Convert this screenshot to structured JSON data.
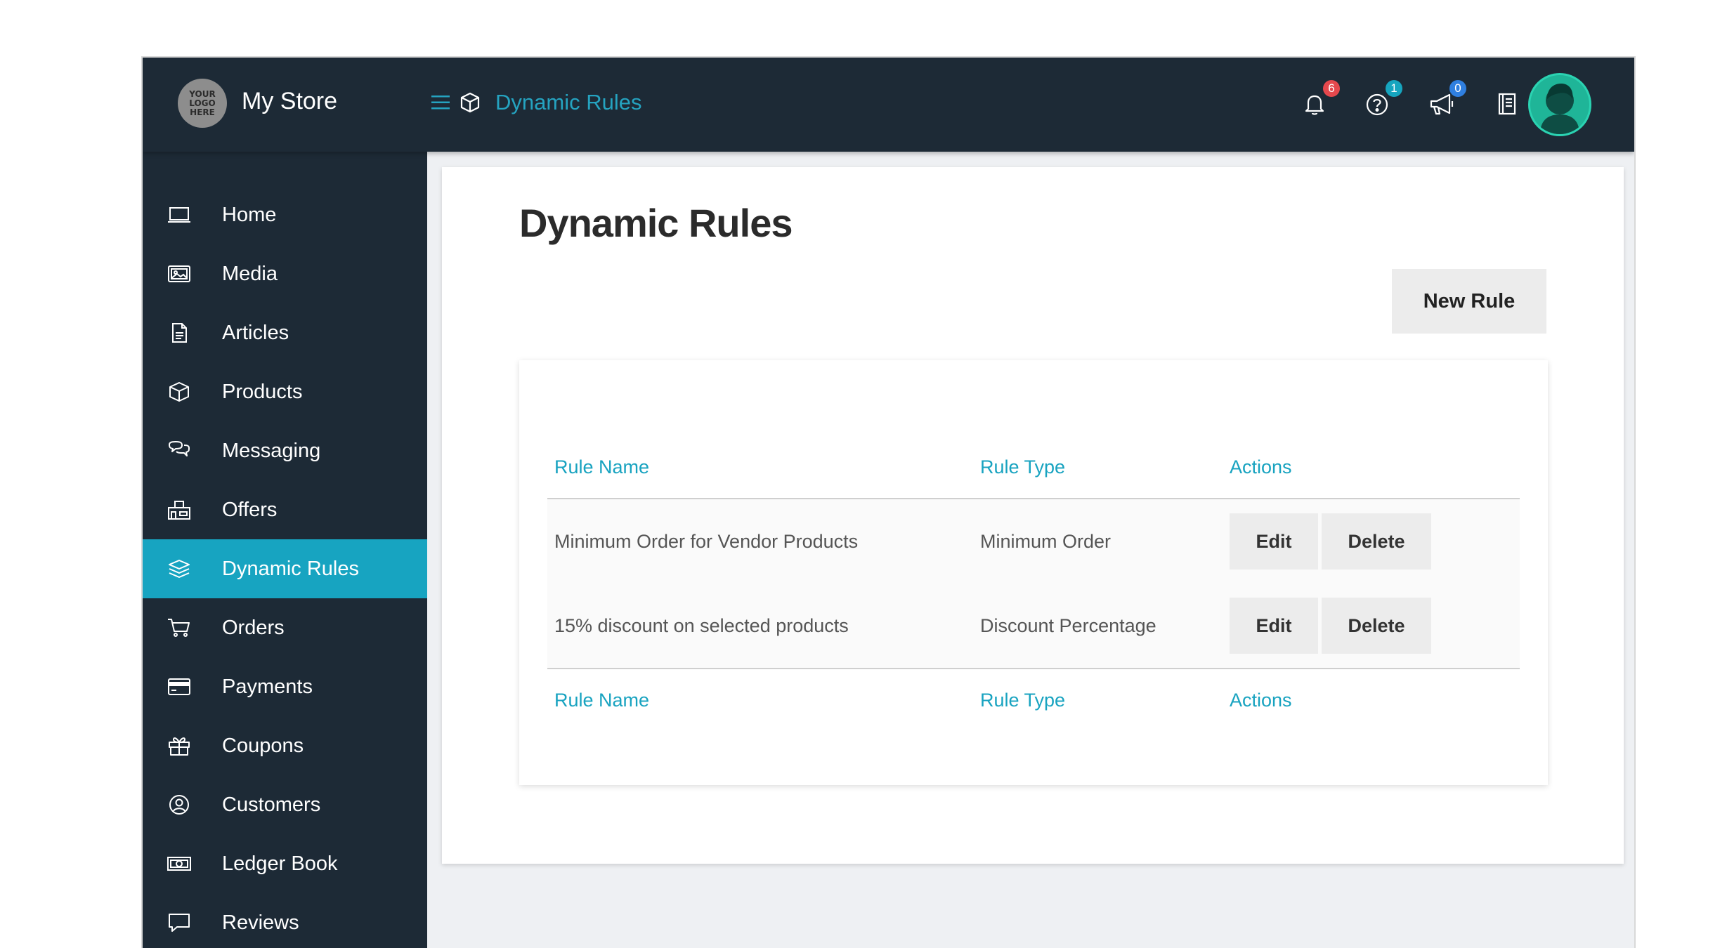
{
  "app": {
    "logo_text": "YOUR LOGO HERE",
    "store_name": "My Store"
  },
  "header": {
    "breadcrumb_title": "Dynamic Rules",
    "notifications": {
      "icon": "bell-icon",
      "count": "6",
      "color": "#e5484d"
    },
    "help": {
      "icon": "question-circle-icon",
      "count": "1",
      "color": "#16a5bf"
    },
    "announcements": {
      "icon": "megaphone-icon",
      "count": "0",
      "color": "#2f7fe0"
    },
    "docs": {
      "icon": "book-icon"
    },
    "avatar": {
      "icon": "user-avatar-icon"
    }
  },
  "sidebar": {
    "active": "Dynamic Rules",
    "items": [
      {
        "label": "Home",
        "icon": "laptop-icon"
      },
      {
        "label": "Media",
        "icon": "image-icon"
      },
      {
        "label": "Articles",
        "icon": "document-icon"
      },
      {
        "label": "Products",
        "icon": "box-icon"
      },
      {
        "label": "Messaging",
        "icon": "chat-icon"
      },
      {
        "label": "Offers",
        "icon": "store-icon"
      },
      {
        "label": "Dynamic Rules",
        "icon": "layers-icon"
      },
      {
        "label": "Orders",
        "icon": "cart-icon"
      },
      {
        "label": "Payments",
        "icon": "credit-card-icon"
      },
      {
        "label": "Coupons",
        "icon": "gift-icon"
      },
      {
        "label": "Customers",
        "icon": "user-circle-icon"
      },
      {
        "label": "Ledger Book",
        "icon": "cash-icon"
      },
      {
        "label": "Reviews",
        "icon": "comment-icon"
      }
    ]
  },
  "main": {
    "title": "Dynamic Rules",
    "new_rule_label": "New Rule",
    "table": {
      "headers": [
        "Rule Name",
        "Rule Type",
        "Actions"
      ],
      "rows": [
        {
          "name": "Minimum Order for Vendor Products",
          "type": "Minimum Order",
          "edit": "Edit",
          "delete": "Delete"
        },
        {
          "name": "15% discount on selected products",
          "type": "Discount Percentage",
          "edit": "Edit",
          "delete": "Delete"
        }
      ],
      "footer": [
        "Rule Name",
        "Rule Type",
        "Actions"
      ]
    }
  },
  "colors": {
    "sidebar_bg": "#1d2a36",
    "accent": "#17a4c1",
    "page_bg": "#eef0f3"
  }
}
